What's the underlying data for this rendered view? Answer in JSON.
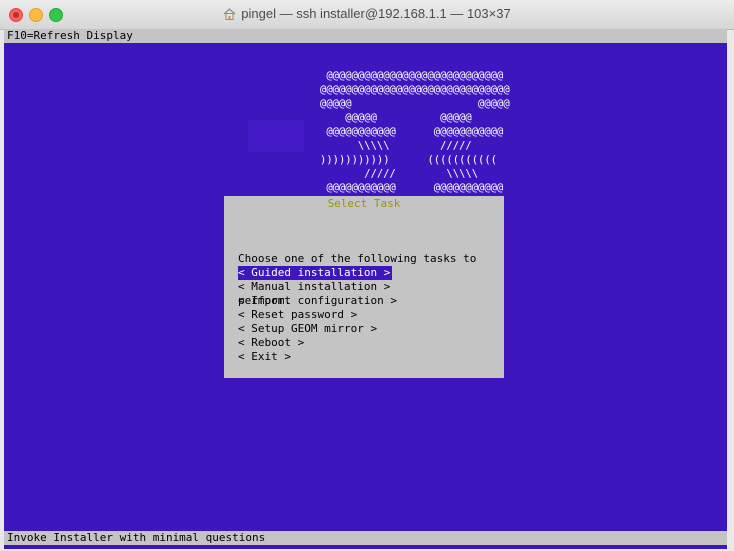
{
  "window": {
    "title": "pingel — ssh installer@192.168.1.1 — 103×37"
  },
  "terminal": {
    "header": "F10=Refresh Display",
    "status": "Invoke Installer with minimal questions",
    "ascii_art": " @@@@@@@@@@@@@@@@@@@@@@@@@@@@\n@@@@@@@@@@@@@@@@@@@@@@@@@@@@@@\n@@@@@                    @@@@@\n    @@@@@          @@@@@\n @@@@@@@@@@@      @@@@@@@@@@@\n      \\\\\\\\\\        /////\n)))))))))))      (((((((((((\n       /////        \\\\\\\\\\\n @@@@@@@@@@@      @@@@@@@@@@@\n                     @@@@@\n                     @@@@@@\n                     @@@@@@@\n                     @@@@@@"
  },
  "dialog": {
    "title": "Select Task",
    "prompt_line1": "Choose one of the following tasks to",
    "prompt_line2": "perform.",
    "items": [
      {
        "label": "< Guided installation >",
        "selected": true
      },
      {
        "label": "< Manual installation >",
        "selected": false
      },
      {
        "label": "< Import configuration >",
        "selected": false
      },
      {
        "label": "< Reset password >",
        "selected": false
      },
      {
        "label": "< Setup GEOM mirror >",
        "selected": false
      },
      {
        "label": "< Reboot >",
        "selected": false
      },
      {
        "label": "< Exit >",
        "selected": false
      }
    ]
  },
  "colors": {
    "terminal_bg": "#3d16bd",
    "dialog_bg": "#c4c4c4",
    "dialog_title": "#969600",
    "selection_bg": "#3d16bd"
  }
}
